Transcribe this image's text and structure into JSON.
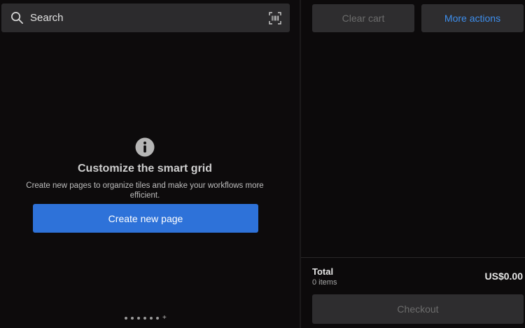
{
  "search": {
    "placeholder": "Search",
    "icon": "search-icon",
    "scan_icon": "barcode-scan-icon"
  },
  "empty_state": {
    "icon": "info-icon",
    "title": "Customize the smart grid",
    "description": "Create new pages to organize tiles and make your workflows more efficient.",
    "create_button_label": "Create new page"
  },
  "pager": {
    "dot_count": 6,
    "has_add_page": true,
    "add_label": "+"
  },
  "cart": {
    "clear_label": "Clear cart",
    "more_actions_label": "More actions",
    "total_label": "Total",
    "items_label": "0 items",
    "total_amount": "US$0.00",
    "checkout_label": "Checkout"
  },
  "colors": {
    "background": "#0c0a0b",
    "surface": "#2e2d2f",
    "accent_blue": "#2e72d9",
    "link_blue": "#3e8eec",
    "disabled_text": "#6d6d6d"
  }
}
